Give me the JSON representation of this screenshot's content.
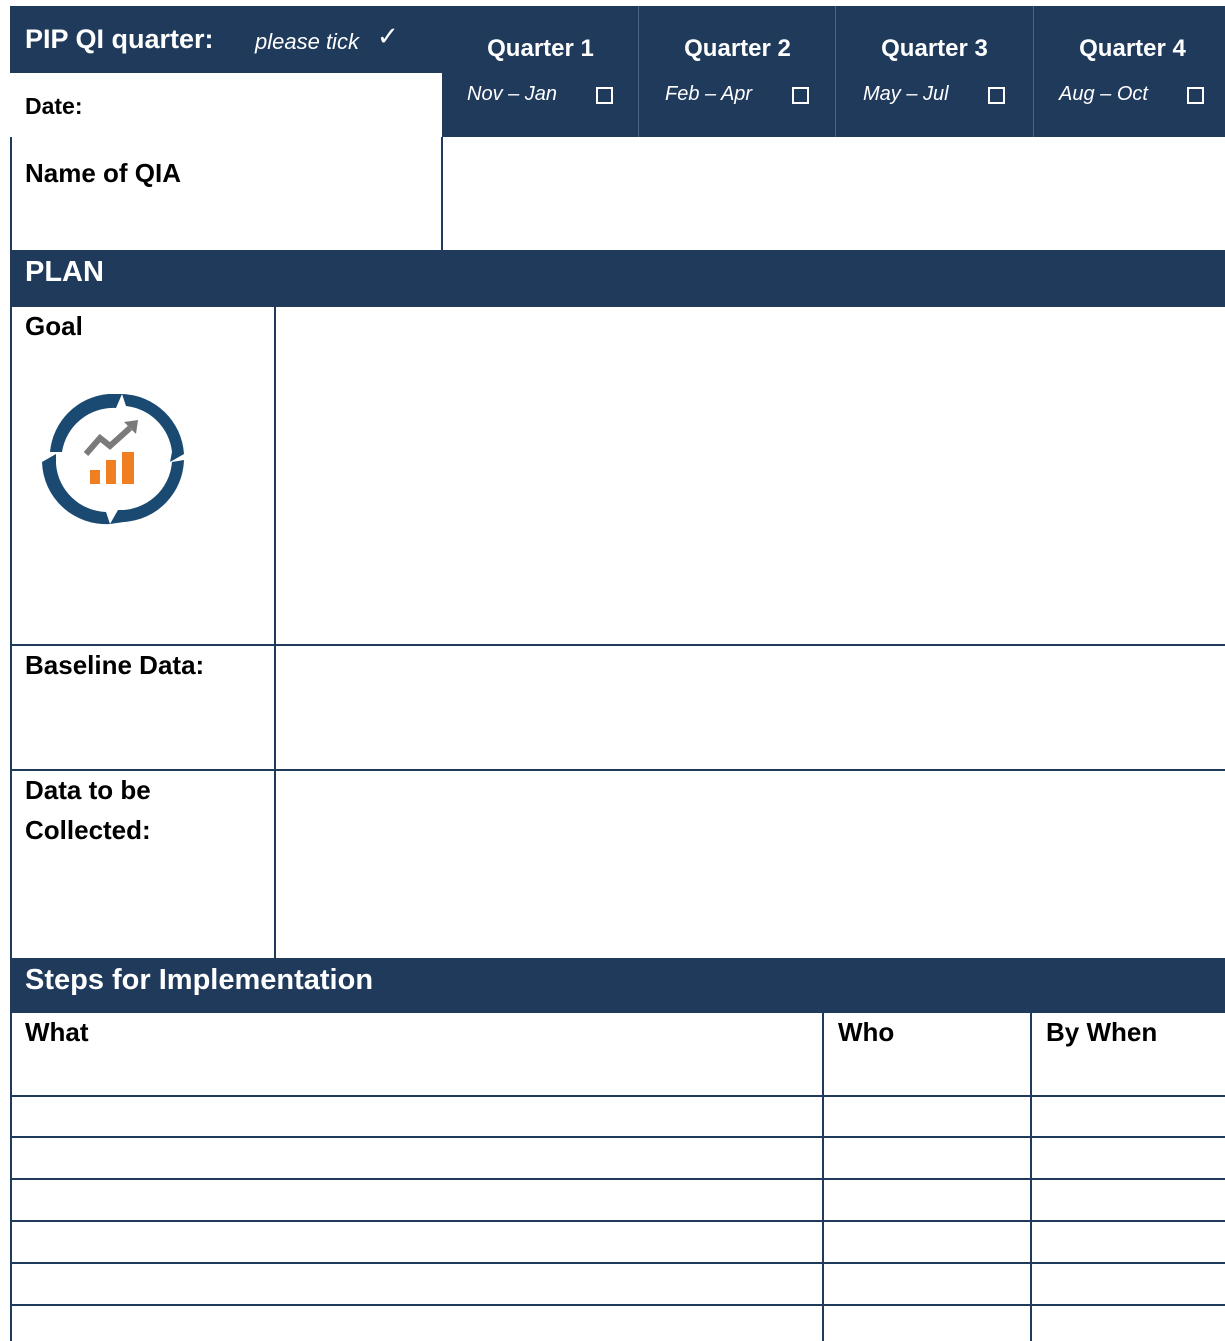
{
  "header": {
    "quarter_label": "PIP QI quarter:",
    "tick_hint": "please tick",
    "tick_mark": "✓",
    "date_label": "Date:",
    "name_label": "Name of QIA",
    "quarters": [
      {
        "label": "Quarter 1",
        "months": "Nov – Jan",
        "checked": false
      },
      {
        "label": "Quarter 2",
        "months": "Feb – Apr",
        "checked": false
      },
      {
        "label": "Quarter 3",
        "months": "May – Jul",
        "checked": false
      },
      {
        "label": "Quarter 4",
        "months": "Aug – Oct",
        "checked": false
      }
    ]
  },
  "plan": {
    "title": "PLAN",
    "goal_label": "Goal",
    "goal_icon": "qi-cycle-chart-icon",
    "baseline_label": "Baseline Data:",
    "data_collected_label_1": "Data to be",
    "data_collected_label_2": "Collected:"
  },
  "steps": {
    "title": "Steps for Implementation",
    "col_what": "What",
    "col_who": "Who",
    "col_when": "By When"
  },
  "colors": {
    "navy": "#1f3a5b",
    "icon_blue": "#1a4a72",
    "icon_orange": "#f07f21",
    "icon_grey": "#7a7a7a"
  }
}
